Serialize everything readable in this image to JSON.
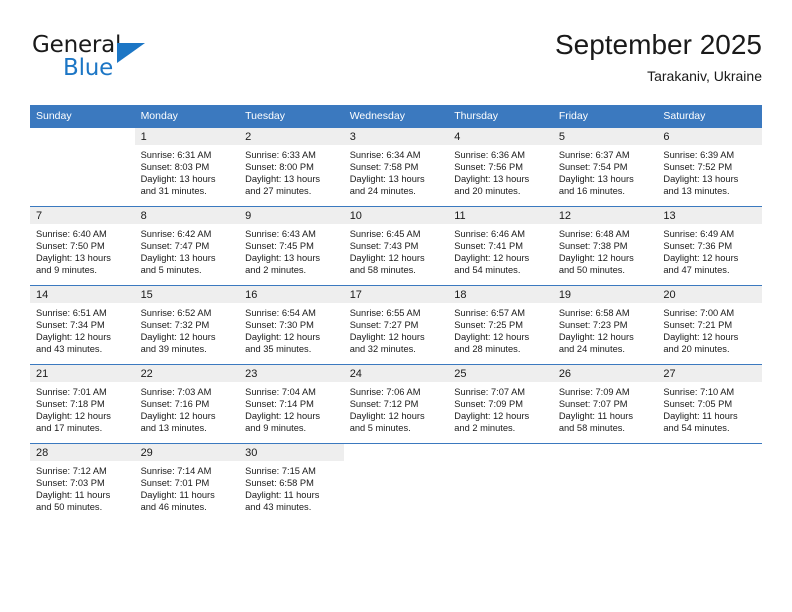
{
  "brand": {
    "name_part1": "General",
    "name_part2": "Blue",
    "accent_color": "#1c76c5"
  },
  "header": {
    "title": "September 2025",
    "location": "Tarakaniv, Ukraine"
  },
  "calendar": {
    "header_color": "#3b79bf",
    "daynum_band_color": "#eeeeee",
    "weekday_headers": [
      "Sunday",
      "Monday",
      "Tuesday",
      "Wednesday",
      "Thursday",
      "Friday",
      "Saturday"
    ],
    "weeks": [
      [
        {
          "day": "",
          "sunrise": "",
          "sunset": "",
          "daylight_line1": "",
          "daylight_line2": ""
        },
        {
          "day": "1",
          "sunrise": "Sunrise: 6:31 AM",
          "sunset": "Sunset: 8:03 PM",
          "daylight_line1": "Daylight: 13 hours",
          "daylight_line2": "and 31 minutes."
        },
        {
          "day": "2",
          "sunrise": "Sunrise: 6:33 AM",
          "sunset": "Sunset: 8:00 PM",
          "daylight_line1": "Daylight: 13 hours",
          "daylight_line2": "and 27 minutes."
        },
        {
          "day": "3",
          "sunrise": "Sunrise: 6:34 AM",
          "sunset": "Sunset: 7:58 PM",
          "daylight_line1": "Daylight: 13 hours",
          "daylight_line2": "and 24 minutes."
        },
        {
          "day": "4",
          "sunrise": "Sunrise: 6:36 AM",
          "sunset": "Sunset: 7:56 PM",
          "daylight_line1": "Daylight: 13 hours",
          "daylight_line2": "and 20 minutes."
        },
        {
          "day": "5",
          "sunrise": "Sunrise: 6:37 AM",
          "sunset": "Sunset: 7:54 PM",
          "daylight_line1": "Daylight: 13 hours",
          "daylight_line2": "and 16 minutes."
        },
        {
          "day": "6",
          "sunrise": "Sunrise: 6:39 AM",
          "sunset": "Sunset: 7:52 PM",
          "daylight_line1": "Daylight: 13 hours",
          "daylight_line2": "and 13 minutes."
        }
      ],
      [
        {
          "day": "7",
          "sunrise": "Sunrise: 6:40 AM",
          "sunset": "Sunset: 7:50 PM",
          "daylight_line1": "Daylight: 13 hours",
          "daylight_line2": "and 9 minutes."
        },
        {
          "day": "8",
          "sunrise": "Sunrise: 6:42 AM",
          "sunset": "Sunset: 7:47 PM",
          "daylight_line1": "Daylight: 13 hours",
          "daylight_line2": "and 5 minutes."
        },
        {
          "day": "9",
          "sunrise": "Sunrise: 6:43 AM",
          "sunset": "Sunset: 7:45 PM",
          "daylight_line1": "Daylight: 13 hours",
          "daylight_line2": "and 2 minutes."
        },
        {
          "day": "10",
          "sunrise": "Sunrise: 6:45 AM",
          "sunset": "Sunset: 7:43 PM",
          "daylight_line1": "Daylight: 12 hours",
          "daylight_line2": "and 58 minutes."
        },
        {
          "day": "11",
          "sunrise": "Sunrise: 6:46 AM",
          "sunset": "Sunset: 7:41 PM",
          "daylight_line1": "Daylight: 12 hours",
          "daylight_line2": "and 54 minutes."
        },
        {
          "day": "12",
          "sunrise": "Sunrise: 6:48 AM",
          "sunset": "Sunset: 7:38 PM",
          "daylight_line1": "Daylight: 12 hours",
          "daylight_line2": "and 50 minutes."
        },
        {
          "day": "13",
          "sunrise": "Sunrise: 6:49 AM",
          "sunset": "Sunset: 7:36 PM",
          "daylight_line1": "Daylight: 12 hours",
          "daylight_line2": "and 47 minutes."
        }
      ],
      [
        {
          "day": "14",
          "sunrise": "Sunrise: 6:51 AM",
          "sunset": "Sunset: 7:34 PM",
          "daylight_line1": "Daylight: 12 hours",
          "daylight_line2": "and 43 minutes."
        },
        {
          "day": "15",
          "sunrise": "Sunrise: 6:52 AM",
          "sunset": "Sunset: 7:32 PM",
          "daylight_line1": "Daylight: 12 hours",
          "daylight_line2": "and 39 minutes."
        },
        {
          "day": "16",
          "sunrise": "Sunrise: 6:54 AM",
          "sunset": "Sunset: 7:30 PM",
          "daylight_line1": "Daylight: 12 hours",
          "daylight_line2": "and 35 minutes."
        },
        {
          "day": "17",
          "sunrise": "Sunrise: 6:55 AM",
          "sunset": "Sunset: 7:27 PM",
          "daylight_line1": "Daylight: 12 hours",
          "daylight_line2": "and 32 minutes."
        },
        {
          "day": "18",
          "sunrise": "Sunrise: 6:57 AM",
          "sunset": "Sunset: 7:25 PM",
          "daylight_line1": "Daylight: 12 hours",
          "daylight_line2": "and 28 minutes."
        },
        {
          "day": "19",
          "sunrise": "Sunrise: 6:58 AM",
          "sunset": "Sunset: 7:23 PM",
          "daylight_line1": "Daylight: 12 hours",
          "daylight_line2": "and 24 minutes."
        },
        {
          "day": "20",
          "sunrise": "Sunrise: 7:00 AM",
          "sunset": "Sunset: 7:21 PM",
          "daylight_line1": "Daylight: 12 hours",
          "daylight_line2": "and 20 minutes."
        }
      ],
      [
        {
          "day": "21",
          "sunrise": "Sunrise: 7:01 AM",
          "sunset": "Sunset: 7:18 PM",
          "daylight_line1": "Daylight: 12 hours",
          "daylight_line2": "and 17 minutes."
        },
        {
          "day": "22",
          "sunrise": "Sunrise: 7:03 AM",
          "sunset": "Sunset: 7:16 PM",
          "daylight_line1": "Daylight: 12 hours",
          "daylight_line2": "and 13 minutes."
        },
        {
          "day": "23",
          "sunrise": "Sunrise: 7:04 AM",
          "sunset": "Sunset: 7:14 PM",
          "daylight_line1": "Daylight: 12 hours",
          "daylight_line2": "and 9 minutes."
        },
        {
          "day": "24",
          "sunrise": "Sunrise: 7:06 AM",
          "sunset": "Sunset: 7:12 PM",
          "daylight_line1": "Daylight: 12 hours",
          "daylight_line2": "and 5 minutes."
        },
        {
          "day": "25",
          "sunrise": "Sunrise: 7:07 AM",
          "sunset": "Sunset: 7:09 PM",
          "daylight_line1": "Daylight: 12 hours",
          "daylight_line2": "and 2 minutes."
        },
        {
          "day": "26",
          "sunrise": "Sunrise: 7:09 AM",
          "sunset": "Sunset: 7:07 PM",
          "daylight_line1": "Daylight: 11 hours",
          "daylight_line2": "and 58 minutes."
        },
        {
          "day": "27",
          "sunrise": "Sunrise: 7:10 AM",
          "sunset": "Sunset: 7:05 PM",
          "daylight_line1": "Daylight: 11 hours",
          "daylight_line2": "and 54 minutes."
        }
      ],
      [
        {
          "day": "28",
          "sunrise": "Sunrise: 7:12 AM",
          "sunset": "Sunset: 7:03 PM",
          "daylight_line1": "Daylight: 11 hours",
          "daylight_line2": "and 50 minutes."
        },
        {
          "day": "29",
          "sunrise": "Sunrise: 7:14 AM",
          "sunset": "Sunset: 7:01 PM",
          "daylight_line1": "Daylight: 11 hours",
          "daylight_line2": "and 46 minutes."
        },
        {
          "day": "30",
          "sunrise": "Sunrise: 7:15 AM",
          "sunset": "Sunset: 6:58 PM",
          "daylight_line1": "Daylight: 11 hours",
          "daylight_line2": "and 43 minutes."
        },
        {
          "day": "",
          "sunrise": "",
          "sunset": "",
          "daylight_line1": "",
          "daylight_line2": ""
        },
        {
          "day": "",
          "sunrise": "",
          "sunset": "",
          "daylight_line1": "",
          "daylight_line2": ""
        },
        {
          "day": "",
          "sunrise": "",
          "sunset": "",
          "daylight_line1": "",
          "daylight_line2": ""
        },
        {
          "day": "",
          "sunrise": "",
          "sunset": "",
          "daylight_line1": "",
          "daylight_line2": ""
        }
      ]
    ]
  }
}
